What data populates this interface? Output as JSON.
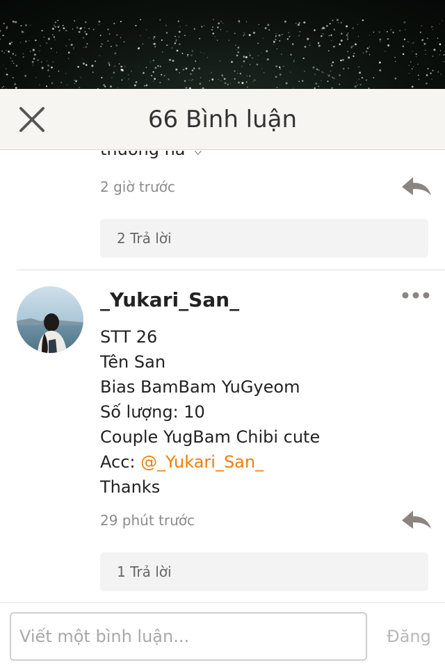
{
  "header": {
    "title": "66 Bình luận"
  },
  "comment_previous": {
    "text_partial": "thương na ♡",
    "time": "2 giờ trước",
    "replies_label": "2 Trả lời"
  },
  "comment_main": {
    "username": "_Yukari_San_",
    "lines": [
      "STT 26",
      "Tên San",
      "Bias BamBam YuGyeom",
      "Số lượng: 10",
      "Couple YugBam Chibi cute"
    ],
    "acc_prefix": "Acc: ",
    "acc_mention": "@_Yukari_San_",
    "last_line": "Thanks",
    "time": "29 phút trước",
    "replies_label": "1 Trả lời"
  },
  "composer": {
    "placeholder": "Viết một bình luận...",
    "post_label": "Đăng"
  },
  "colors": {
    "mention": "#f07d0a",
    "header_bg": "#f6f5f1",
    "reply_icon": "#8a8580"
  }
}
